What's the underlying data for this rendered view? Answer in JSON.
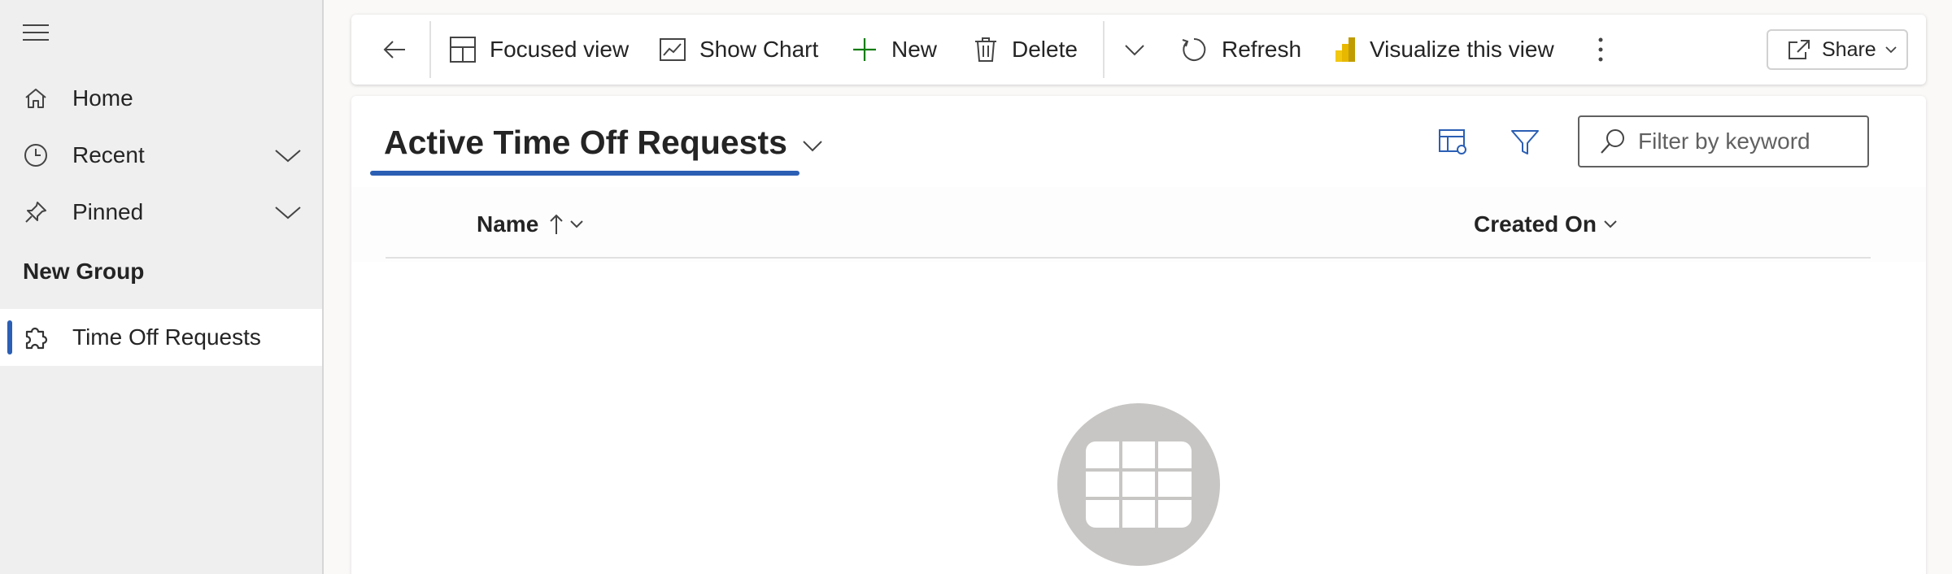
{
  "sidebar": {
    "items": [
      {
        "label": "Home",
        "icon": "home-icon"
      },
      {
        "label": "Recent",
        "icon": "clock-icon"
      },
      {
        "label": "Pinned",
        "icon": "pin-icon"
      }
    ],
    "group_title": "New Group",
    "group_items": [
      {
        "label": "Time Off Requests",
        "icon": "puzzle-icon",
        "selected": true
      }
    ]
  },
  "toolbar": {
    "focused_view": "Focused view",
    "show_chart": "Show Chart",
    "new": "New",
    "delete": "Delete",
    "refresh": "Refresh",
    "visualize": "Visualize this view",
    "share": "Share"
  },
  "view": {
    "title": "Active Time Off Requests",
    "filter_placeholder": "Filter by keyword",
    "columns": [
      {
        "label": "Name",
        "sort": "ascending"
      },
      {
        "label": "Created On"
      }
    ]
  },
  "colors": {
    "accent": "#2b5fb4",
    "new_icon": "#107c10",
    "powerbi": "#f2c811"
  }
}
